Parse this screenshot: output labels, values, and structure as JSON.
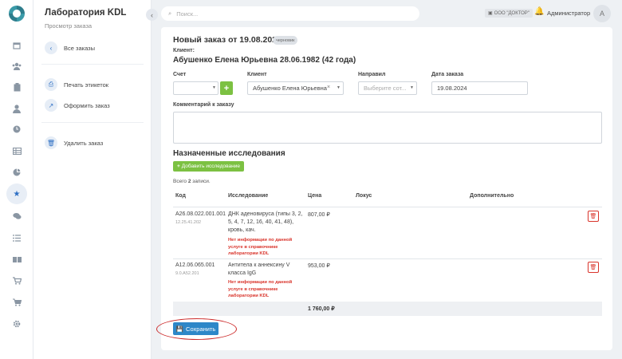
{
  "panel": {
    "title": "Лаборатория KDL",
    "subtitle": "Просмотр заказа",
    "all_orders": "Все заказы",
    "print_labels": "Печать этикеток",
    "place_order": "Оформить заказ",
    "delete_order": "Удалить заказ"
  },
  "rail": {
    "icons": [
      "calendar-icon",
      "users-icon",
      "clipboard-icon",
      "user-icon",
      "clock-icon",
      "table-icon",
      "pie-chart-icon",
      "star-icon",
      "chat-icon",
      "list-icon",
      "boxes-icon",
      "cart-icon",
      "cart-plus-icon",
      "gear-icon"
    ],
    "active": "star-icon"
  },
  "topbar": {
    "search_placeholder": "Поиск...",
    "org": "ООО \"ДОКТОР\"",
    "user": "Администратор",
    "avatar_letter": "А"
  },
  "order": {
    "title": "Новый заказ от 19.08.2024",
    "status": "черновик",
    "client_label": "Клиент:",
    "patient": "Абушенко Елена Юрьевна 28.06.1982 (42 года)",
    "account_label": "Счет",
    "account_value": "",
    "client_field_label": "Клиент",
    "client_value": "Абушенко Елена Юрьевна",
    "referrer_label": "Направил",
    "referrer_placeholder": "Выберите сот...",
    "date_label": "Дата заказа",
    "date_value": "19.08.2024",
    "comment_label": "Комментарий к заказу",
    "comment_value": ""
  },
  "studies": {
    "heading": "Назначенные исследования",
    "add_button": "Добавить исследование",
    "total_prefix": "Всего ",
    "total_count": "2",
    "total_suffix": " записи.",
    "columns": {
      "code": "Код",
      "study": "Исследование",
      "price": "Цена",
      "locus": "Локус",
      "extra": "Дополнительно"
    },
    "rows": [
      {
        "code": "A26.08.022.001.001",
        "sub": "12.25.41.202",
        "name": "ДНК аденовируса (типы 3, 2, 5, 4, 7, 12, 16, 40, 41, 48), кровь, кач.",
        "warning": "Нет информации по данной услуге в справочнике лаборатории KDL",
        "price": "807,00 ₽"
      },
      {
        "code": "A12.06.065.001",
        "sub": "9.0.A52.201",
        "name": "Антитела к аннексину V класса IgG",
        "warning": "Нет информации по данной услуге в справочнике лаборатории KDL",
        "price": "953,00 ₽"
      }
    ],
    "sum": "1 760,00 ₽"
  },
  "save_label": "Сохранить",
  "colors": {
    "accent": "#2d87c8",
    "green": "#7cc142",
    "warning": "#d9342b",
    "annotation": "#cc2a2a"
  }
}
